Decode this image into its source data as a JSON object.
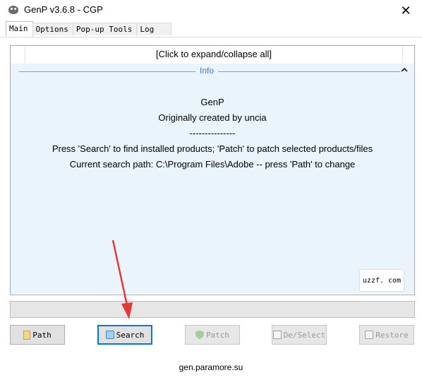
{
  "window": {
    "title": "GenP v3.6.8 - CGP",
    "close_glyph": "✕"
  },
  "tabs": [
    {
      "label": "Main",
      "active": true
    },
    {
      "label": "Options",
      "active": false
    },
    {
      "label": "Pop-up Tools",
      "active": false
    },
    {
      "label": "Log",
      "active": false
    }
  ],
  "main": {
    "expand_label": "[Click to expand/collapse all]",
    "info_section_label": "Info",
    "info_lines": [
      "GenP",
      "Originally created by uncia",
      "---------------",
      "Press 'Search' to find installed products; 'Patch' to patch selected products/files",
      "Current search path: C:\\Program Files\\Adobe -- press 'Path' to change"
    ],
    "watermark": "uzzf. com"
  },
  "buttons": {
    "path": {
      "label": "Path",
      "icon": "folder-icon"
    },
    "search": {
      "label": "Search",
      "icon": "search-icon"
    },
    "patch": {
      "label": "Patch",
      "icon": "shield-icon"
    },
    "deselect": {
      "label": "De/Select",
      "icon": "checkbox-icon"
    },
    "restore": {
      "label": "Restore",
      "icon": "restore-icon"
    }
  },
  "footer": {
    "url": "gen.paramore.su"
  },
  "colors": {
    "accent": "#0078d7",
    "info_band": "#eaf4fd",
    "info_text": "#3a7bd5",
    "arrow": "#e53935"
  }
}
